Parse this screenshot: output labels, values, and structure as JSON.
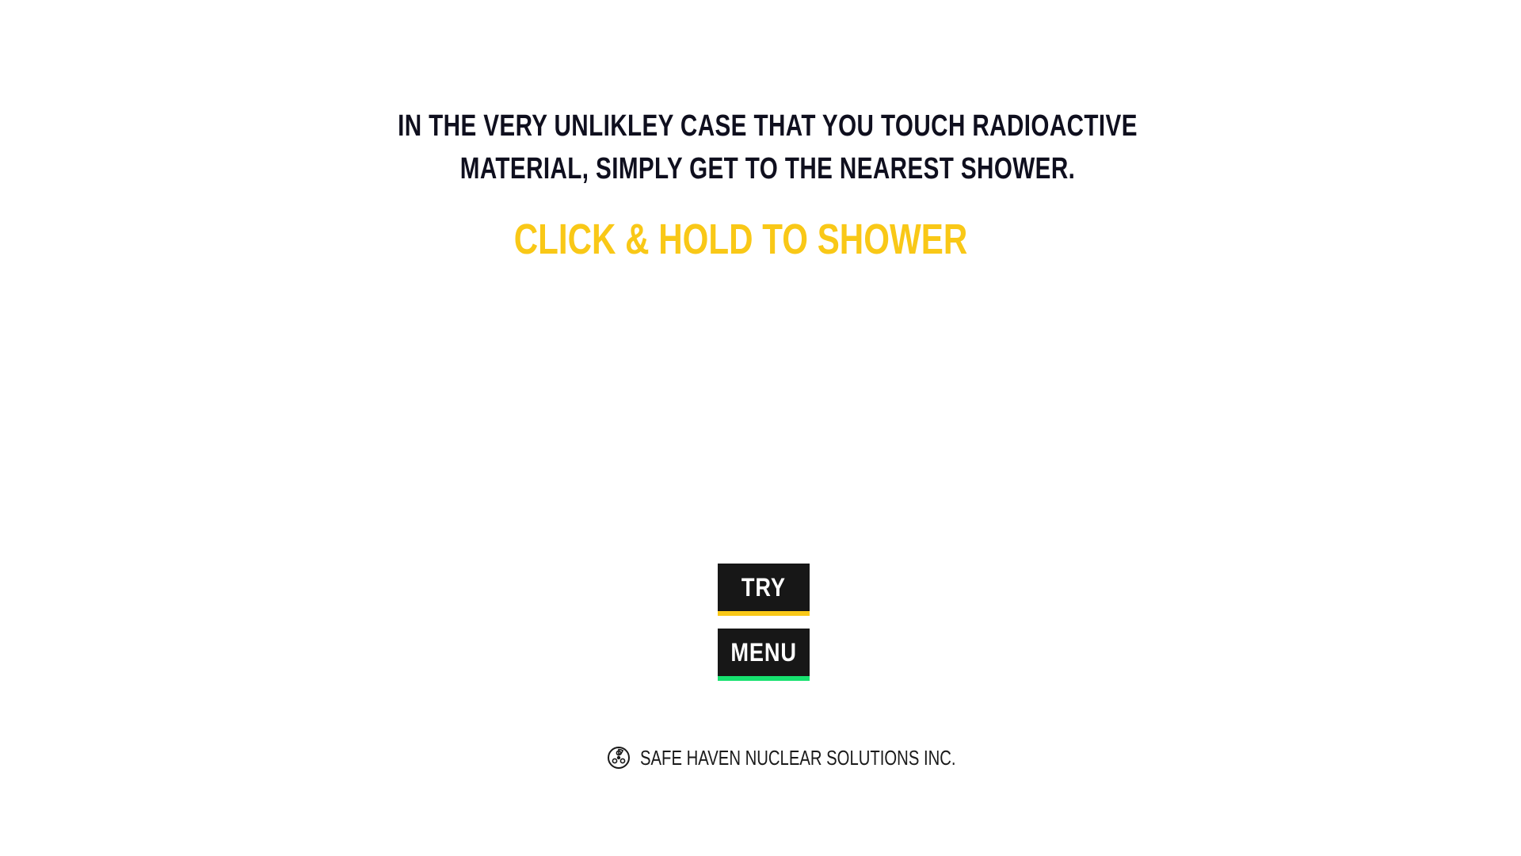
{
  "instructions": {
    "line1": "IN THE VERY UNLIKLEY CASE THAT YOU TOUCH RADIOACTIVE",
    "line2": "MATERIAL, SIMPLY GET TO THE  NEAREST SHOWER."
  },
  "prompt": "CLICK & HOLD TO SHOWER",
  "buttons": {
    "try_label": "TRY",
    "menu_label": "MENU"
  },
  "footer": {
    "company": "SAFE HAVEN NUCLEAR SOLUTIONS INC.",
    "logo_icon": "radiation-icon"
  },
  "colors": {
    "text_dark": "#0f0f1e",
    "accent_yellow": "#f9c817",
    "accent_green": "#17e26f",
    "button_bg": "#171717",
    "background": "#ffffff"
  }
}
